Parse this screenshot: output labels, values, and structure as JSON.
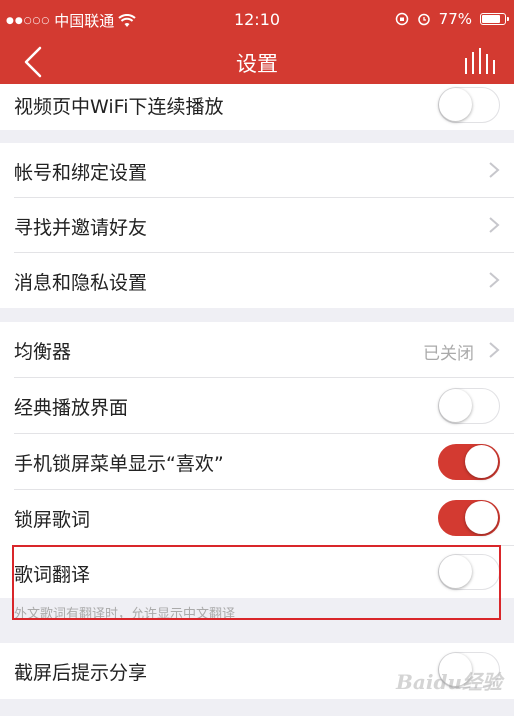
{
  "status_bar": {
    "signal_dots": "●●○○○",
    "carrier": "中国联通",
    "wifi_icon": "wifi-icon",
    "time": "12:10",
    "battery_percent": "77%",
    "battery_level": 0.77
  },
  "nav": {
    "title": "设置",
    "back_icon": "chevron-left-icon",
    "equalizer_icon": "equalizer-bars-icon"
  },
  "rows": {
    "wifi_autoplay": {
      "label": "视频页中WiFi下连续播放",
      "on": false
    },
    "account_binding": {
      "label": "帐号和绑定设置"
    },
    "invite_friends": {
      "label": "寻找并邀请好友"
    },
    "privacy": {
      "label": "消息和隐私设置"
    },
    "equalizer": {
      "label": "均衡器",
      "value": "已关闭"
    },
    "classic_player": {
      "label": "经典播放界面",
      "on": false
    },
    "lockscreen_like": {
      "label": "手机锁屏菜单显示“喜欢”",
      "on": true
    },
    "lockscreen_lyrics": {
      "label": "锁屏歌词",
      "on": true
    },
    "lyrics_translate": {
      "label": "歌词翻译",
      "on": false,
      "hint": "外文歌词有翻译时，允许显示中文翻译"
    },
    "screenshot_share": {
      "label": "截屏后提示分享",
      "on": false
    }
  },
  "watermark": "Baidu经验",
  "colors": {
    "accent": "#d33a31",
    "highlight": "#d9262a",
    "background": "#efeff4"
  }
}
